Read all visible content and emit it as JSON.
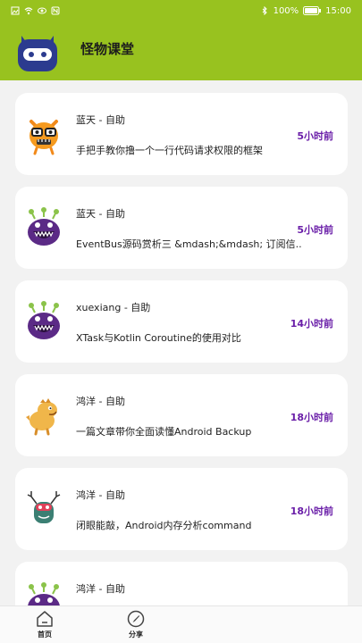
{
  "status_bar": {
    "battery": "100%",
    "time": "15:00"
  },
  "header": {
    "title": "怪物课堂"
  },
  "posts": [
    {
      "author": "蓝天 - 自助",
      "time": "5小时前",
      "title": "手把手教你撸一个一行代码请求权限的框架",
      "avatar_icon": "orange-glasses-monster-icon"
    },
    {
      "author": "蓝天 - 自助",
      "time": "5小时前",
      "title": "EventBus源码赏析三 &mdash;&mdash; 订阅信..",
      "avatar_icon": "purple-antenna-monster-icon"
    },
    {
      "author": "xuexiang - 自助",
      "time": "14小时前",
      "title": "XTask与Kotlin Coroutine的使用对比",
      "avatar_icon": "purple-antenna-monster-icon"
    },
    {
      "author": "鸿洋 - 自助",
      "time": "18小时前",
      "title": "一篇文章带你全面读懂Android Backup",
      "avatar_icon": "yellow-dino-monster-icon"
    },
    {
      "author": "鸿洋 - 自助",
      "time": "18小时前",
      "title": "闭眼能敲，Android内存分析command",
      "avatar_icon": "antler-monster-icon"
    },
    {
      "author": "鸿洋 - 自助",
      "time": "",
      "title": "",
      "avatar_icon": "purple-antenna-monster-icon"
    }
  ],
  "tabbar": {
    "home_label": "首页",
    "share_label": "分享"
  },
  "colors": {
    "brand_green": "#98c21f",
    "time_purple": "#6a1ea8"
  }
}
